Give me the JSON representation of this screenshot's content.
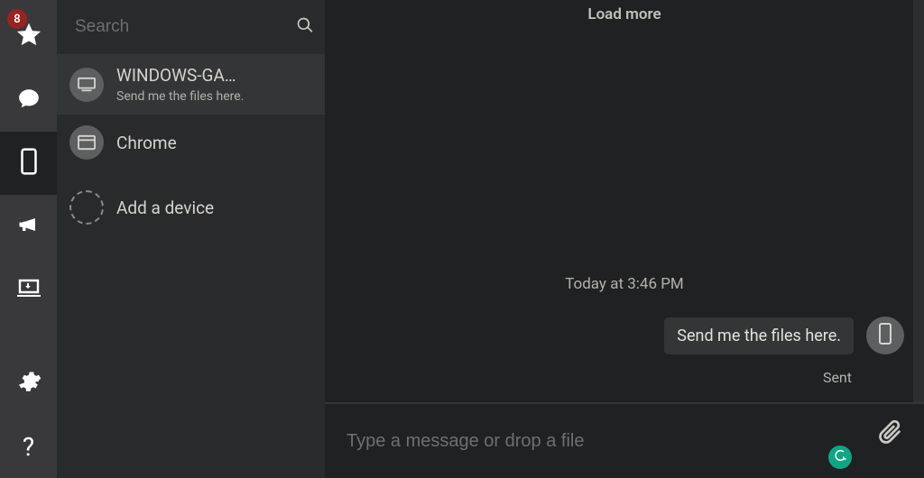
{
  "rail": {
    "badge_count": "8"
  },
  "sidebar": {
    "search_placeholder": "Search",
    "devices": [
      {
        "name": "WINDOWS-GA…",
        "preview": "Send me the files here."
      },
      {
        "name": "Chrome",
        "preview": ""
      }
    ],
    "add_device_label": "Add a device"
  },
  "chat": {
    "load_more": "Load more",
    "timestamp": "Today at 3:46 PM",
    "message": "Send me the files here.",
    "status": "Sent",
    "composer_placeholder": "Type a message or drop a file"
  }
}
